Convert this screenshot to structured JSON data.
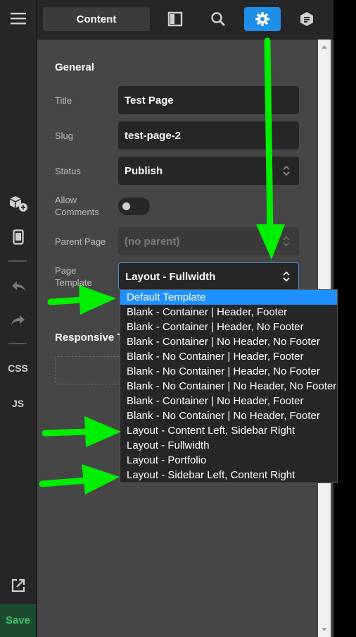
{
  "rail": {
    "css_label": "CSS",
    "js_label": "JS",
    "save_label": "Save"
  },
  "topbar": {
    "content_tab": "Content"
  },
  "general": {
    "section_title": "General",
    "title_label": "Title",
    "title_value": "Test Page",
    "slug_label": "Slug",
    "slug_value": "test-page-2",
    "status_label": "Status",
    "status_value": "Publish",
    "allow_comments_label": "Allow Comments",
    "allow_comments_on": false,
    "parent_page_label": "Parent Page",
    "parent_page_value": "(no parent)",
    "page_template_label": "Page Template",
    "page_template_value": "Layout - Fullwidth"
  },
  "responsive": {
    "section_title": "Responsive To"
  },
  "dropdown": {
    "selected_index": 0,
    "options": [
      "Default Template",
      "Blank - Container | Header, Footer",
      "Blank - Container | Header, No Footer",
      "Blank - Container | No Header, No Footer",
      "Blank - No Container | Header, Footer",
      "Blank - No Container | Header, No Footer",
      "Blank - No Container | No Header, No Footer",
      "Blank - Container | No Header, Footer",
      "Blank - No Container | No Header, Footer",
      "Layout - Content Left, Sidebar Right",
      "Layout - Fullwidth",
      "Layout - Portfolio",
      "Layout - Sidebar Left, Content Right"
    ]
  },
  "colors": {
    "accent_blue": "#1f8ee6",
    "annotation_green": "#00ee00",
    "save_green": "#3dc46d"
  }
}
